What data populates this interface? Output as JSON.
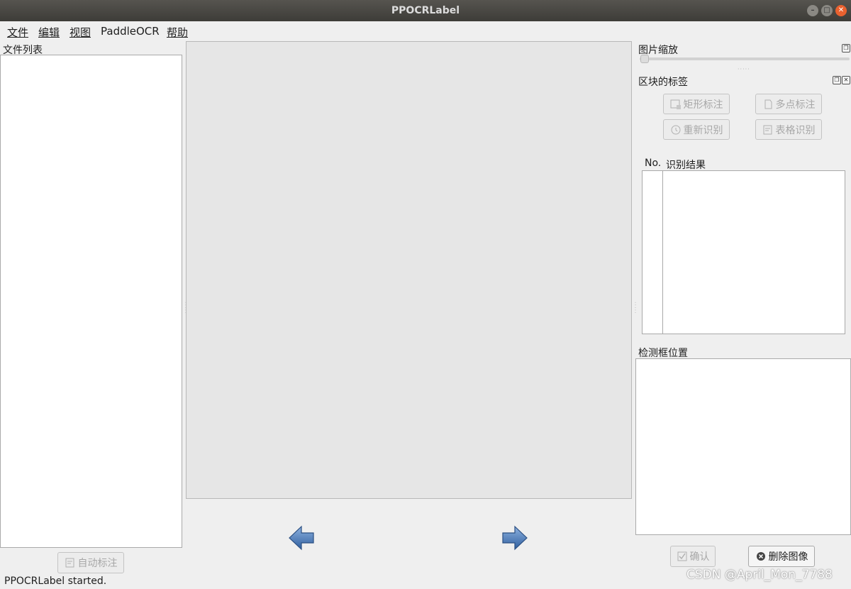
{
  "window": {
    "title": "PPOCRLabel"
  },
  "menu": [
    {
      "label": "文件"
    },
    {
      "label": "编辑"
    },
    {
      "label": "视图"
    },
    {
      "label": "PaddleOCR"
    },
    {
      "label": "帮助"
    }
  ],
  "file_list": {
    "title": "文件列表",
    "auto_label_button": "自动标注"
  },
  "zoom": {
    "title": "图片缩放",
    "value": 0
  },
  "block_labels": {
    "title": "区块的标签",
    "rect_button": "矩形标注",
    "poly_button": "多点标注",
    "reocr_button": "重新识别",
    "table_button": "表格识别",
    "table_header": {
      "no": "No.",
      "result": "识别结果"
    }
  },
  "box_position": {
    "title": "检测框位置"
  },
  "bottom": {
    "confirm_button": "确认",
    "delete_button": "删除图像"
  },
  "status": {
    "text": "PPOCRLabel started."
  },
  "watermark": {
    "text": "CSDN @April_Mon_7788"
  },
  "colors": {
    "title_bar": "#46443f",
    "close_button": "#e9612f",
    "arrow_blue": "#4a78b8",
    "canvas": "#e6e6e6"
  }
}
